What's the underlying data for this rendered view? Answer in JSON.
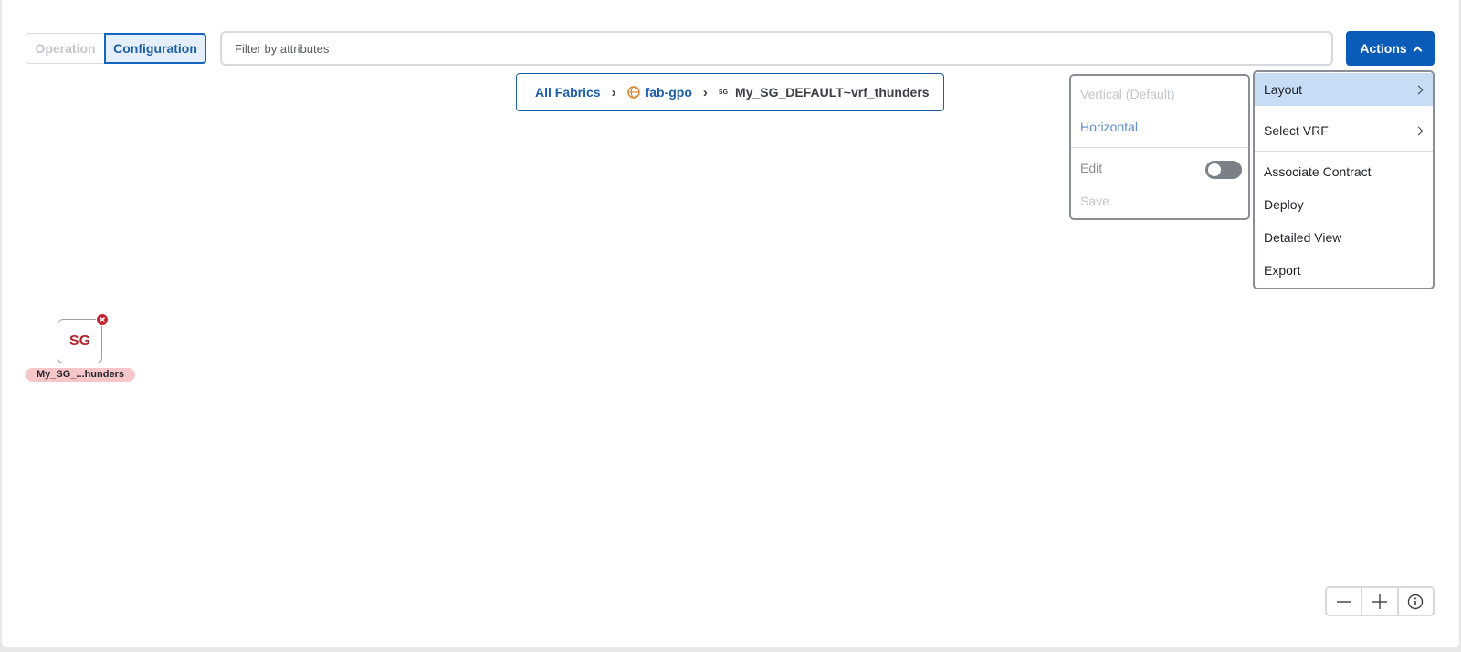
{
  "mode_toggle": {
    "operation": "Operation",
    "configuration": "Configuration"
  },
  "filter": {
    "placeholder": "Filter by attributes",
    "value": ""
  },
  "actions_button": {
    "label": "Actions"
  },
  "breadcrumb": {
    "items": [
      {
        "label": "All Fabrics"
      },
      {
        "label": "fab-gpo",
        "icon": "globe-icon"
      },
      {
        "label": "My_SG_DEFAULT~vrf_thunders",
        "icon_text": "SG"
      }
    ]
  },
  "layout_submenu": {
    "vertical": "Vertical (Default)",
    "horizontal": "Horizontal",
    "edit": "Edit",
    "edit_enabled": false,
    "save": "Save"
  },
  "actions_menu": {
    "items": [
      {
        "label": "Layout",
        "has_submenu": true,
        "highlighted": true
      },
      {
        "label": "Select VRF",
        "has_submenu": true
      },
      {
        "label": "Associate Contract"
      },
      {
        "label": "Deploy"
      },
      {
        "label": "Detailed View"
      },
      {
        "label": "Export"
      }
    ]
  },
  "graph_node": {
    "icon_text": "SG",
    "label": "My_SG_...hunders",
    "status": "error",
    "status_color": "#c8212f"
  },
  "zoom_controls": {
    "zoom_out": "zoom-out-icon",
    "zoom_in": "zoom-in-icon",
    "info": "info-icon"
  },
  "colors": {
    "accent": "#0b5bb8",
    "highlight": "#c7dcf5",
    "error": "#c8212f"
  }
}
